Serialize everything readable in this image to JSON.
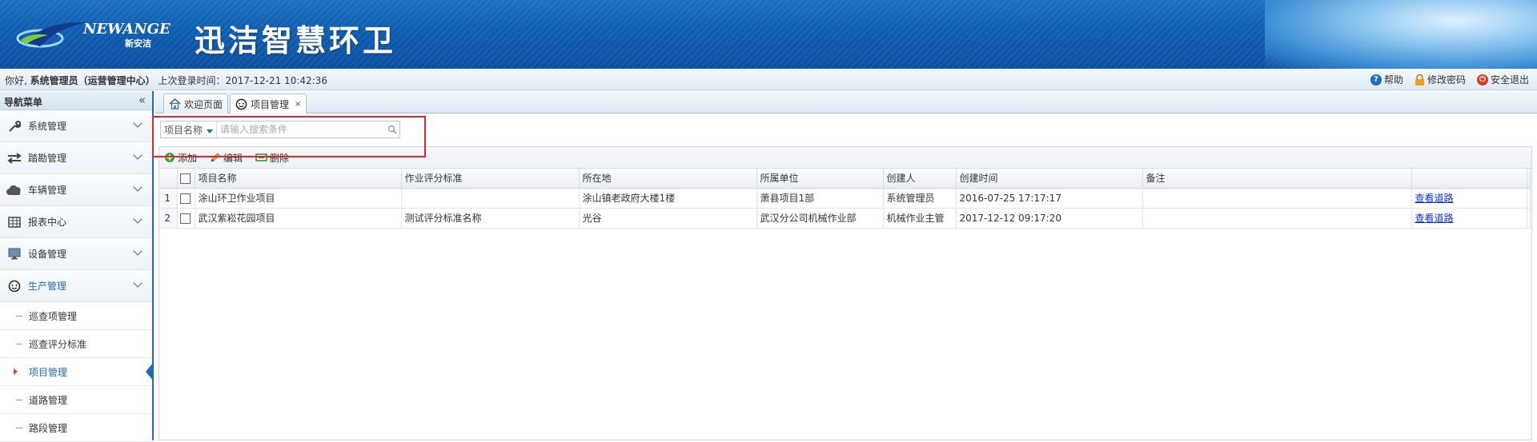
{
  "header": {
    "brand_en": "NEWANGE",
    "brand_cn": "新安洁",
    "app_title": "迅洁智慧环卫"
  },
  "userbar": {
    "greeting": "你好,",
    "user": "系统管理员（运营管理中心）",
    "last_login": "上次登录时间：2017-12-21 10:42:36",
    "help": "帮助",
    "change_password": "修改密码",
    "logout": "安全退出"
  },
  "sidebar": {
    "title": "导航菜单",
    "collapse": "«",
    "items": [
      {
        "label": "系统管理",
        "icon": "wrench-icon"
      },
      {
        "label": "踏勘管理",
        "icon": "arrows-icon"
      },
      {
        "label": "车辆管理",
        "icon": "cloud-icon"
      },
      {
        "label": "报表中心",
        "icon": "table-icon"
      },
      {
        "label": "设备管理",
        "icon": "monitor-icon"
      },
      {
        "label": "生产管理",
        "icon": "smiley-icon"
      }
    ],
    "subitems": [
      "巡查项管理",
      "巡查评分标准",
      "项目管理",
      "道路管理",
      "路段管理"
    ]
  },
  "tabs": [
    {
      "label": "欢迎页面",
      "icon": "home-icon"
    },
    {
      "label": "项目管理",
      "icon": "smiley-icon",
      "close": "×"
    }
  ],
  "search": {
    "field": "项目名称",
    "placeholder": "请输入搜索条件"
  },
  "toolbar": {
    "add": "添加",
    "edit": "编辑",
    "delete": "删除"
  },
  "table": {
    "columns": [
      "项目名称",
      "作业评分标准",
      "所在地",
      "所属单位",
      "创建人",
      "创建时间",
      "备注",
      ""
    ],
    "rows": [
      {
        "no": "1",
        "name": "涂山环卫作业项目",
        "standard": "",
        "location": "涂山镇老政府大楼1楼",
        "unit": "萧县项目1部",
        "creator": "系统管理员",
        "created": "2016-07-25 17:17:17",
        "remark": "",
        "action": "查看道路"
      },
      {
        "no": "2",
        "name": "武汉紫崧花园项目",
        "standard": "测试评分标准名称",
        "location": "光谷",
        "unit": "武汉分公司机械作业部",
        "creator": "机械作业主管",
        "created": "2017-12-12 09:17:20",
        "remark": "",
        "action": "查看道路"
      }
    ]
  }
}
